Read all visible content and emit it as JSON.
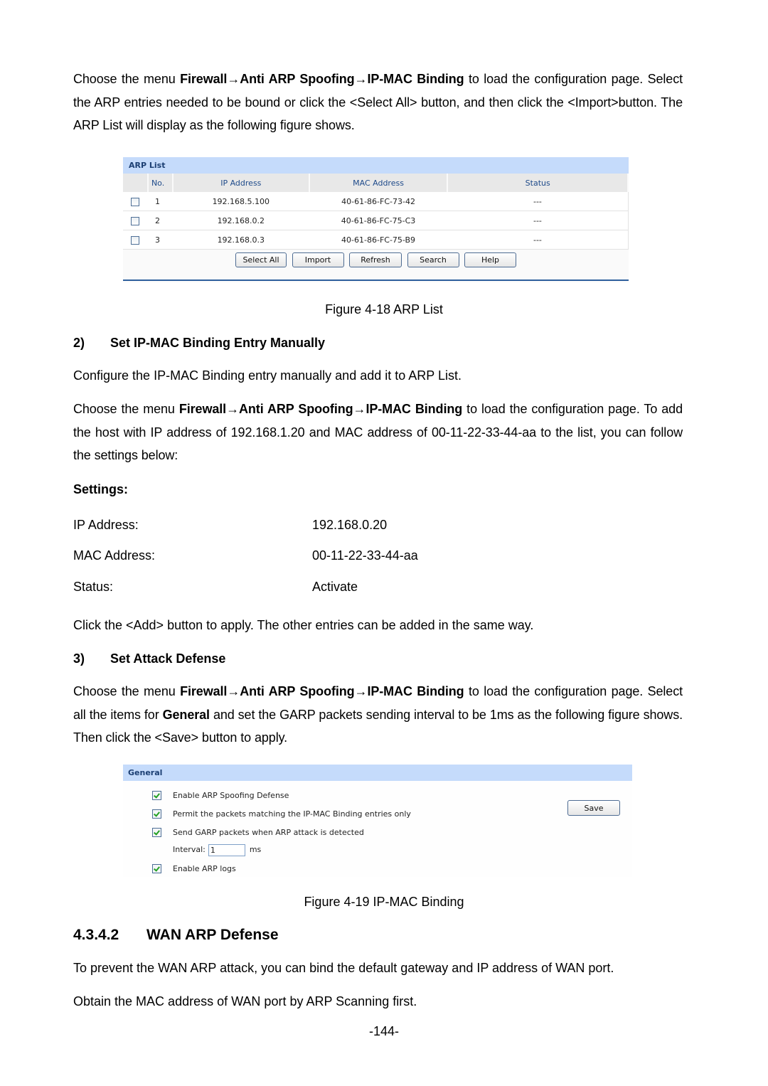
{
  "intro": {
    "prefix": "Choose the menu ",
    "menu_path": [
      "Firewall",
      "Anti ARP Spoofing",
      "IP-MAC Binding"
    ],
    "arrow": "→",
    "suffix": " to load the configuration page. Select the ARP entries needed to be bound or click the <Select All> button, and then click the <Import>button. The ARP List will display as the following figure shows."
  },
  "arp_list": {
    "title": "ARP List",
    "columns": [
      "",
      "No.",
      "IP Address",
      "MAC Address",
      "Status"
    ],
    "rows": [
      {
        "checked": false,
        "no": "1",
        "ip": "192.168.5.100",
        "mac": "40-61-86-FC-73-42",
        "status": "---"
      },
      {
        "checked": false,
        "no": "2",
        "ip": "192.168.0.2",
        "mac": "40-61-86-FC-75-C3",
        "status": "---"
      },
      {
        "checked": false,
        "no": "3",
        "ip": "192.168.0.3",
        "mac": "40-61-86-FC-75-B9",
        "status": "---"
      }
    ],
    "buttons": [
      "Select All",
      "Import",
      "Refresh",
      "Search",
      "Help"
    ]
  },
  "figure_18_caption": "Figure 4-18 ARP List",
  "section2": {
    "number": "2)",
    "title": "Set IP-MAC Binding Entry Manually",
    "desc": "Configure the IP-MAC Binding entry manually and add it to ARP List.",
    "para_prefix": "Choose the menu ",
    "para_suffix": " to load the configuration page. To add the host with IP address of 192.168.1.20 and MAC address of 00-11-22-33-44-aa to the list, you can follow the settings below:",
    "settings_label": "Settings:",
    "settings": [
      {
        "label": "IP Address:",
        "value": "192.168.0.20"
      },
      {
        "label": "MAC Address:",
        "value": "00-11-22-33-44-aa"
      },
      {
        "label": "Status:",
        "value": "Activate"
      }
    ],
    "after": "Click the <Add> button to apply. The other entries can be added in the same way."
  },
  "section3": {
    "number": "3)",
    "title": "Set Attack Defense",
    "para_prefix": "Choose the menu ",
    "para_mid": " to load the configuration page. Select all the items for ",
    "general_bold": "General",
    "para_suffix": " and set the GARP packets sending interval to be 1ms as the following figure shows. Then click the <Save> button to apply."
  },
  "general_panel": {
    "title": "General",
    "options": [
      {
        "label": "Enable ARP Spoofing Defense",
        "checked": true
      },
      {
        "label": "Permit the packets matching the IP-MAC Binding entries only",
        "checked": true
      },
      {
        "label": "Send GARP packets when ARP attack is detected",
        "checked": true
      },
      {
        "label": "Enable ARP logs",
        "checked": true
      }
    ],
    "interval_label": "Interval:",
    "interval_value": "1",
    "interval_unit": "ms",
    "save_label": "Save"
  },
  "figure_19_caption": "Figure 4-19 IP-MAC Binding",
  "wan_section": {
    "number": "4.3.4.2",
    "title": "WAN ARP Defense",
    "para1": "To prevent the WAN ARP attack, you can bind the default gateway and IP address of WAN port.",
    "para2": "Obtain the MAC address of WAN port by ARP Scanning first."
  },
  "page_number": "-144-"
}
